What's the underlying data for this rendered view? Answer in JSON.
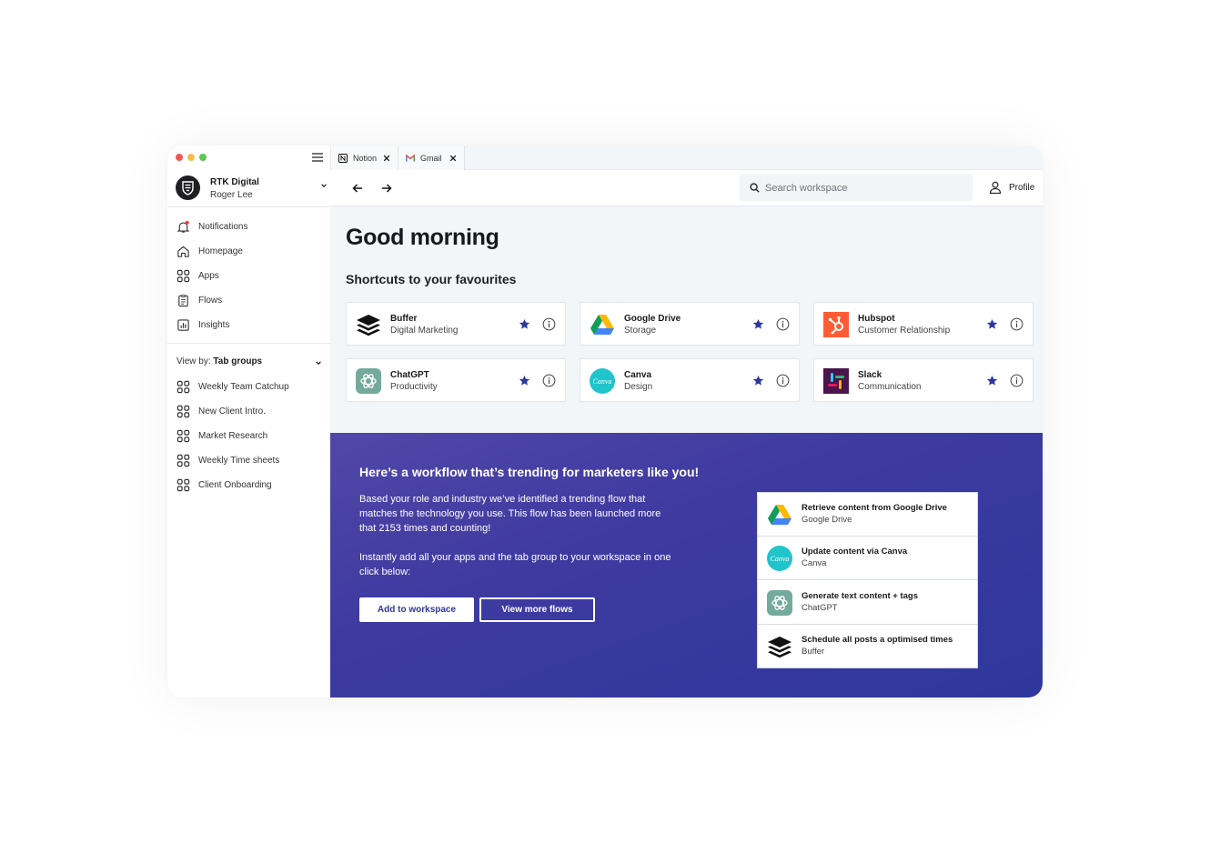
{
  "window": {
    "traffic_colors": [
      "#ee5a52",
      "#f5bd4f",
      "#61c454"
    ]
  },
  "sidebar": {
    "account": {
      "name": "RTK Digital",
      "user": "Roger Lee"
    },
    "nav": [
      {
        "label": "Notifications",
        "icon": "bell-icon"
      },
      {
        "label": "Homepage",
        "icon": "home-icon"
      },
      {
        "label": "Apps",
        "icon": "apps-grid-icon"
      },
      {
        "label": "Flows",
        "icon": "clipboard-icon"
      },
      {
        "label": "Insights",
        "icon": "bar-chart-icon"
      }
    ],
    "view_by": {
      "label": "View by:",
      "value": "Tab groups"
    },
    "tab_groups": [
      {
        "label": "Weekly Team Catchup"
      },
      {
        "label": "New Client Intro."
      },
      {
        "label": "Market Research"
      },
      {
        "label": "Weekly Time sheets"
      },
      {
        "label": "Client Onboarding"
      }
    ]
  },
  "tabs": [
    {
      "label": "Notion",
      "icon": "notion-icon"
    },
    {
      "label": "Gmail",
      "icon": "gmail-icon"
    }
  ],
  "toolbar": {
    "search_placeholder": "Search workspace",
    "profile_label": "Profile"
  },
  "main": {
    "greeting": "Good morning",
    "shortcuts_title": "Shortcuts to your favourites",
    "shortcuts": [
      {
        "name": "Buffer",
        "category": "Digital Marketing",
        "logo": "buffer-logo"
      },
      {
        "name": "Google Drive",
        "category": "Storage",
        "logo": "google-drive-logo"
      },
      {
        "name": "Hubspot",
        "category": "Customer Relationship",
        "logo": "hubspot-logo"
      },
      {
        "name": "ChatGPT",
        "category": "Productivity",
        "logo": "chatgpt-logo"
      },
      {
        "name": "Canva",
        "category": "Design",
        "logo": "canva-logo"
      },
      {
        "name": "Slack",
        "category": "Communication",
        "logo": "slack-logo"
      }
    ],
    "accent_color": "#2e379d"
  },
  "promo": {
    "title": "Here’s a workflow that’s trending for marketers like you!",
    "para1_line1": "Based your role and industry we’ve identified a trending flow that",
    "para1_line2": "matches the technology you use. This flow has been launched more",
    "para1_line3": "that 2153 times and counting!",
    "para2_line1": "Instantly add all your apps and the tab group to your workspace in one",
    "para2_line2": "click below:",
    "primary_button": "Add to workspace",
    "secondary_button": "View more flows",
    "steps": [
      {
        "title": "Retrieve content from Google Drive",
        "app": "Google Drive",
        "logo": "google-drive-logo"
      },
      {
        "title": "Update content via Canva",
        "app": "Canva",
        "logo": "canva-logo"
      },
      {
        "title": "Generate text content + tags",
        "app": "ChatGPT",
        "logo": "chatgpt-logo"
      },
      {
        "title": "Schedule all posts a optimised times",
        "app": "Buffer",
        "logo": "buffer-logo"
      }
    ]
  }
}
